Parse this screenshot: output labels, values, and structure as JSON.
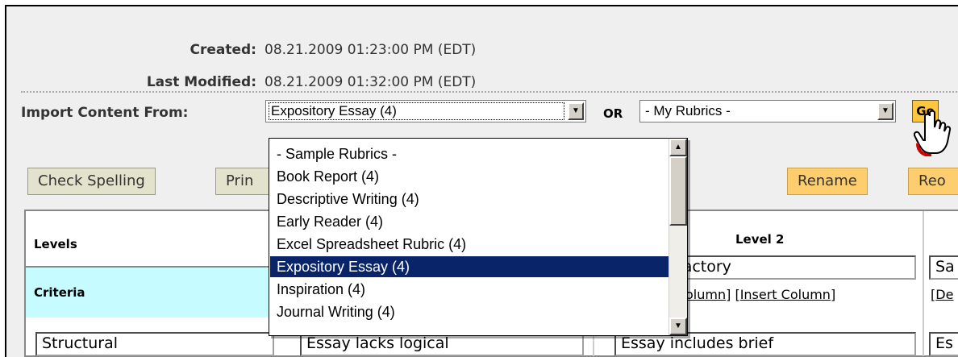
{
  "meta": {
    "created_label": "Created:",
    "created_value": "08.21.2009 01:23:00 PM (EDT)",
    "modified_label": "Last Modified:",
    "modified_value": "08.21.2009 01:32:00 PM (EDT)"
  },
  "import": {
    "label": "Import Content From:",
    "selected": "Expository Essay (4)",
    "or_label": "OR",
    "my_rubrics": "- My Rubrics -",
    "go_label": "Go"
  },
  "toolbar": {
    "check_spelling": "Check Spelling",
    "print": "Prin",
    "rename": "Rename",
    "reo": "Reo"
  },
  "table": {
    "levels": "Levels",
    "criteria": "Criteria",
    "level2": "Level 2",
    "level2_value": "factory",
    "level3_value": "Sa",
    "col_links_left": "olumn",
    "insert_column": "Insert Column",
    "de": "De",
    "row1_criterion": "Structural",
    "row1_l1": "Essay lacks logical",
    "row1_l2": "Essay includes brief",
    "row1_l3": "Es"
  },
  "dropdown": {
    "items": [
      "- Sample Rubrics -",
      "Book Report (4)",
      "Descriptive Writing (4)",
      "Early Reader (4)",
      "Excel Spreadsheet Rubric (4)",
      "Expository Essay (4)",
      "Inspiration (4)",
      "Journal Writing (4)"
    ],
    "selected_index": 5
  },
  "colors": {
    "selection": "#0a246a",
    "go_button": "#fdc63f",
    "orange_button": "#fdcd6e",
    "criteria_header": "#c6fbff"
  },
  "icons": [
    "hand-cursor-icon",
    "dropdown-arrow-icon",
    "scroll-up-icon",
    "scroll-down-icon"
  ]
}
